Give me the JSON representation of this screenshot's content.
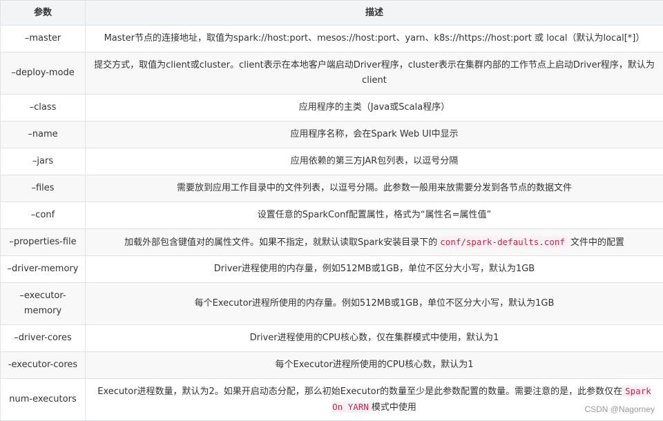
{
  "header": {
    "param": "参数",
    "desc": "描述"
  },
  "rows": [
    {
      "param": "–master",
      "desc": "Master节点的连接地址，取值为spark://host:port、mesos://host:port、yarn、k8s://https://host:port 或 local（默认为local[*]）"
    },
    {
      "param": "–deploy-mode",
      "desc": "提交方式，取值为client或cluster。client表示在本地客户端启动Driver程序，cluster表示在集群内部的工作节点上启动Driver程序，默认为client"
    },
    {
      "param": "–class",
      "desc": "应用程序的主类（Java或Scala程序）"
    },
    {
      "param": "–name",
      "desc": "应用程序名称，会在Spark Web UI中显示"
    },
    {
      "param": "–jars",
      "desc": "应用依赖的第三方JAR包列表，以逗号分隔"
    },
    {
      "param": "–files",
      "desc": "需要放到应用工作目录中的文件列表，以逗号分隔。此参数一般用来放需要分发到各节点的数据文件"
    },
    {
      "param": "–conf",
      "desc": "设置任意的SparkConf配置属性，格式为“属性名=属性值”"
    },
    {
      "param": "–properties-file",
      "desc_before": "加载外部包含键值对的属性文件。如果不指定，就默认读取Spark安装目录下的",
      "code": "conf/spark-defaults.conf",
      "desc_after": "文件中的配置"
    },
    {
      "param": "–driver-memory",
      "desc": "Driver进程使用的内存量，例如512MB或1GB，单位不区分大小写，默认为1GB"
    },
    {
      "param": "–executor-memory",
      "desc": "每个Executor进程所使用的内存量。例如512MB或1GB，单位不区分大小写，默认为1GB"
    },
    {
      "param": "–driver-cores",
      "desc": "Driver进程使用的CPU核心数，仅在集群模式中使用，默认为1"
    },
    {
      "param": "-executor-cores",
      "desc": "每个Executor进程所使用的CPU核心数，默认为1"
    },
    {
      "param": "num-executors",
      "desc_before": "Executor进程数量，默认为2。如果开启动态分配，那么初始Executor的数量至少是此参数配置的数量。需要注意的是，此参数仅在",
      "code": "Spark On YARN",
      "desc_after": "模式中使用"
    }
  ],
  "watermark": "CSDN @Nagorney"
}
